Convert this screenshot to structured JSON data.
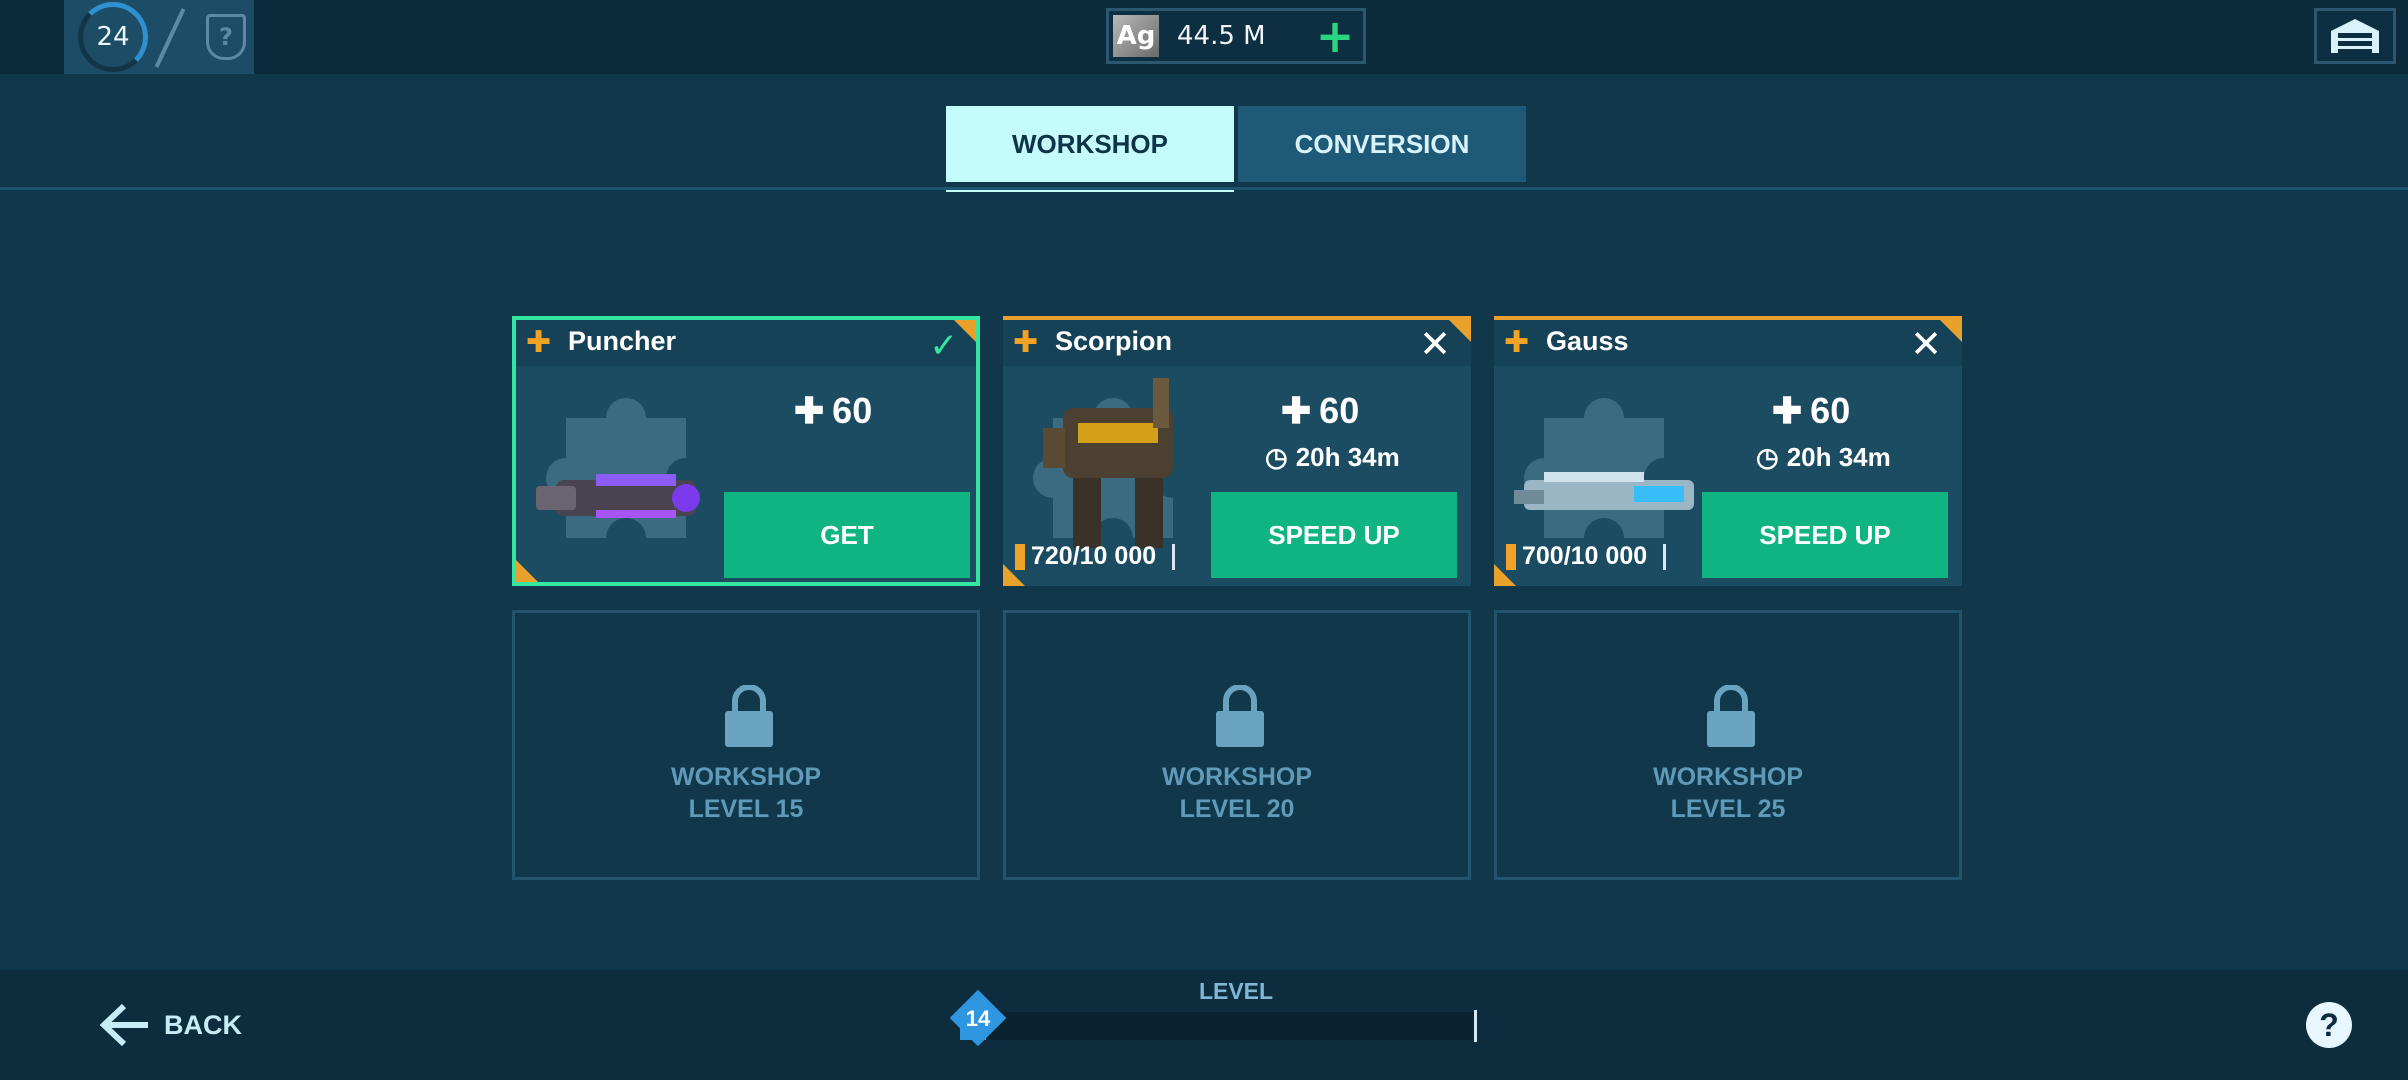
{
  "topbar": {
    "player_level": "24",
    "currency_symbol": "Ag",
    "currency_amount": "44.5 M",
    "add_currency_label": "+"
  },
  "tabs": [
    {
      "label": "WORKSHOP",
      "active": true
    },
    {
      "label": "CONVERSION",
      "active": false
    }
  ],
  "cards": [
    {
      "name": "Puncher",
      "cost": "60",
      "button_label": "GET",
      "status": "ready"
    },
    {
      "name": "Scorpion",
      "cost": "60",
      "timer": "20h 34m",
      "progress": "720/10 000",
      "button_label": "SPEED UP",
      "status": "in_progress"
    },
    {
      "name": "Gauss",
      "cost": "60",
      "timer": "20h 34m",
      "progress": "700/10 000",
      "button_label": "SPEED UP",
      "status": "in_progress"
    }
  ],
  "locked_slots": [
    {
      "line1": "WORKSHOP",
      "line2": "LEVEL 15"
    },
    {
      "line1": "WORKSHOP",
      "line2": "LEVEL 20"
    },
    {
      "line1": "WORKSHOP",
      "line2": "LEVEL 25"
    }
  ],
  "bottombar": {
    "back_label": "BACK",
    "level_title": "LEVEL",
    "workshop_level": "14",
    "level_progress": 0.05,
    "help_label": "?"
  },
  "colors": {
    "accent_green": "#10b482",
    "active_border": "#35e6a2",
    "orange_accent": "#e8a12a",
    "tab_active_bg": "#c4fbfd"
  }
}
